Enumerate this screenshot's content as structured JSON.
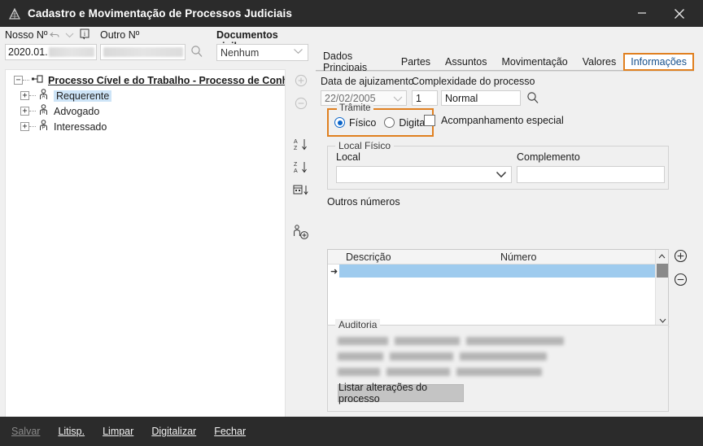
{
  "window": {
    "title": "Cadastro e Movimentação de Processos Judiciais",
    "app_icon": "pyramid-icon",
    "minimize_label": "—",
    "close_label": "✕"
  },
  "colors": {
    "accent_orange": "#e08020",
    "titlebar_bg": "#2b2b2b",
    "panel_bg": "#f0f0f0",
    "selection_blue": "#9ecbee",
    "tab_active_text": "#16508c",
    "radio_blue": "#0a64c8"
  },
  "top_form": {
    "nosso_numero": {
      "label": "Nosso Nº",
      "value": "2020.01.",
      "redacted": true
    },
    "outro_numero": {
      "label": "Outro Nº",
      "value": "",
      "redacted": true
    },
    "documentos_sigilosos": {
      "label": "Documentos sigilosos",
      "value": "Nenhum",
      "options": [
        "Nenhum"
      ]
    },
    "icons": [
      "undo-icon",
      "chevron-down-icon",
      "info-icon",
      "search-icon"
    ]
  },
  "tree": {
    "root": {
      "label": "Processo Cível e do Trabalho - Processo de Conhecimento",
      "expander": "−",
      "icon": "process-node-icon"
    },
    "children": [
      {
        "label": "Requerente",
        "expander": "+",
        "icon": "person-a-icon",
        "selected": true
      },
      {
        "label": "Advogado",
        "expander": "+",
        "icon": "person-r-icon",
        "selected": false
      },
      {
        "label": "Interessado",
        "expander": "+",
        "icon": "person-p-icon",
        "selected": false
      }
    ],
    "hscroll": {
      "left_arrow": "‹",
      "right_arrow": "›"
    }
  },
  "tree_toolbar": {
    "items": [
      {
        "name": "add-party-button",
        "glyph": "⊕",
        "disabled": true
      },
      {
        "name": "remove-party-button",
        "glyph": "⊖",
        "disabled": true
      },
      {
        "name": "sort-az-button",
        "glyph": "A-Z↓",
        "disabled": false
      },
      {
        "name": "sort-za-button",
        "glyph": "Z-A↓",
        "disabled": false
      },
      {
        "name": "sort-date-button",
        "glyph": "cal↓",
        "disabled": false
      },
      {
        "name": "add-person-button",
        "glyph": "person⊕",
        "disabled": false
      }
    ]
  },
  "tabs": [
    {
      "label": "Dados Principais",
      "active": false
    },
    {
      "label": "Partes",
      "active": false
    },
    {
      "label": "Assuntos",
      "active": false
    },
    {
      "label": "Movimentação",
      "active": false
    },
    {
      "label": "Valores",
      "active": false
    },
    {
      "label": "Informações",
      "active": true
    }
  ],
  "informacoes": {
    "data_ajuizamento": {
      "label": "Data de ajuizamento",
      "value": "22/02/2005"
    },
    "complexidade": {
      "label": "Complexidade do processo",
      "code": "1",
      "value": "Normal",
      "search_icon": "search-icon"
    },
    "tramite": {
      "legend": "Trâmite",
      "options": [
        {
          "label": "Físico",
          "selected": true
        },
        {
          "label": "Digital",
          "selected": false
        }
      ],
      "highlighted": true
    },
    "acompanhamento_especial": {
      "label": "Acompanhamento especial",
      "checked": false
    },
    "local_fisico": {
      "legend": "Local Físico",
      "local": {
        "label": "Local",
        "value": ""
      },
      "complemento": {
        "label": "Complemento",
        "value": ""
      }
    },
    "outros_numeros": {
      "label": "Outros números",
      "columns": [
        "Descrição",
        "Número"
      ],
      "rows": [
        {
          "descricao": "",
          "numero": "",
          "selected": true
        }
      ],
      "add_button": "⊕",
      "remove_button": "⊖",
      "scroll_up": "⌃",
      "scroll_down": "⌄",
      "scroll_left": "‹",
      "scroll_right": "›"
    },
    "auditoria": {
      "legend": "Auditoria",
      "lines": [
        "",
        "",
        ""
      ],
      "lines_redacted": true,
      "button_label": "Listar alterações do processo"
    }
  },
  "bottom_bar": {
    "items": [
      {
        "label": "Salvar",
        "disabled": true
      },
      {
        "label": "Litisp.",
        "disabled": false
      },
      {
        "label": "Limpar",
        "disabled": false
      },
      {
        "label": "Digitalizar",
        "disabled": false
      },
      {
        "label": "Fechar",
        "disabled": false
      }
    ]
  }
}
